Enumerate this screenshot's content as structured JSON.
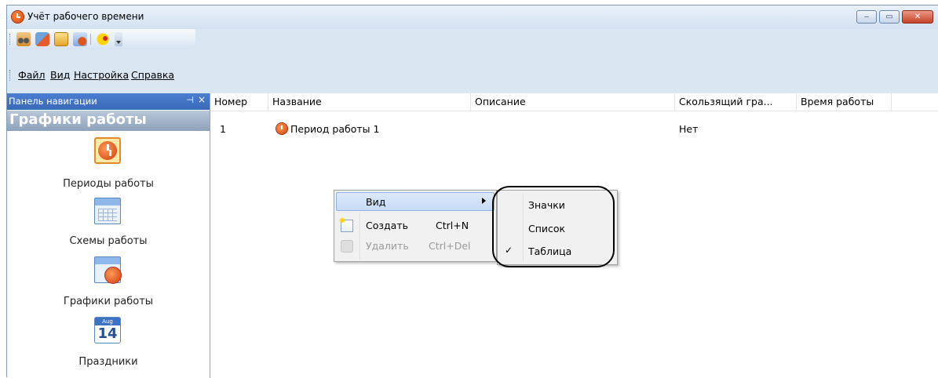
{
  "window": {
    "title": "Учёт рабочего времени",
    "controls": {
      "minimize": "‒",
      "maximize": "▭",
      "close": "✕"
    }
  },
  "menu": {
    "file": "Файл",
    "view": "Вид",
    "settings": "Настройка",
    "help": "Справка"
  },
  "nav": {
    "header": "Панель навигации",
    "pin": "⊣",
    "close": "×",
    "title": "Графики работы",
    "items": [
      {
        "label": "Периоды работы"
      },
      {
        "label": "Схемы работы"
      },
      {
        "label": "Графики работы"
      },
      {
        "label": "Праздники",
        "icon_month": "Aug",
        "icon_day": "14"
      }
    ]
  },
  "table": {
    "columns": [
      "Номер",
      "Название",
      "Описание",
      "Скользящий гра...",
      "Время работы"
    ],
    "rows": [
      {
        "number": "1",
        "name": "Период работы 1",
        "description": "",
        "sliding": "Нет",
        "work_time": ""
      }
    ]
  },
  "context_menu": {
    "view": "Вид",
    "create": "Создать",
    "create_shortcut": "Ctrl+N",
    "delete": "Удалить",
    "delete_shortcut": "Ctrl+Del"
  },
  "view_submenu": {
    "icons": "Значки",
    "list": "Список",
    "table": "Таблица",
    "checked": "✓"
  },
  "colors": {
    "nav_header": "#3a69b8",
    "highlight": "#c6dbf6",
    "accent_icon": "#d03d08"
  }
}
